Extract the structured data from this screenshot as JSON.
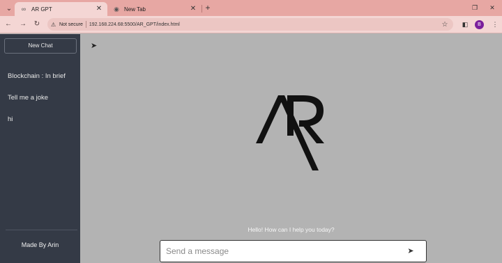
{
  "browser": {
    "tabs": [
      {
        "title": "AR GPT",
        "active": true,
        "favicon": "ar-logo-icon"
      },
      {
        "title": "New Tab",
        "active": false,
        "favicon": "chrome-icon"
      }
    ],
    "security_label": "Not secure",
    "url": "192.168.224.68:5500/AR_GPT/index.html",
    "profile_initial": "B",
    "colors": {
      "tabstrip": "#e7a7a3",
      "toolbar": "#f4d6d4",
      "profile": "#7b1f9c"
    }
  },
  "sidebar": {
    "new_chat_label": "New Chat",
    "history": [
      "Blockchain : In brief",
      "Tell me a joke",
      "hi"
    ],
    "footer": "Made By Arin"
  },
  "main": {
    "logo_name": "ar-logo",
    "greeting": "Hello! How can I help you today?",
    "input_placeholder": "Send a message",
    "input_value": ""
  },
  "colors": {
    "sidebar": "#343a46",
    "main_bg": "#b3b3b3",
    "input_bg": "#ffffff"
  }
}
